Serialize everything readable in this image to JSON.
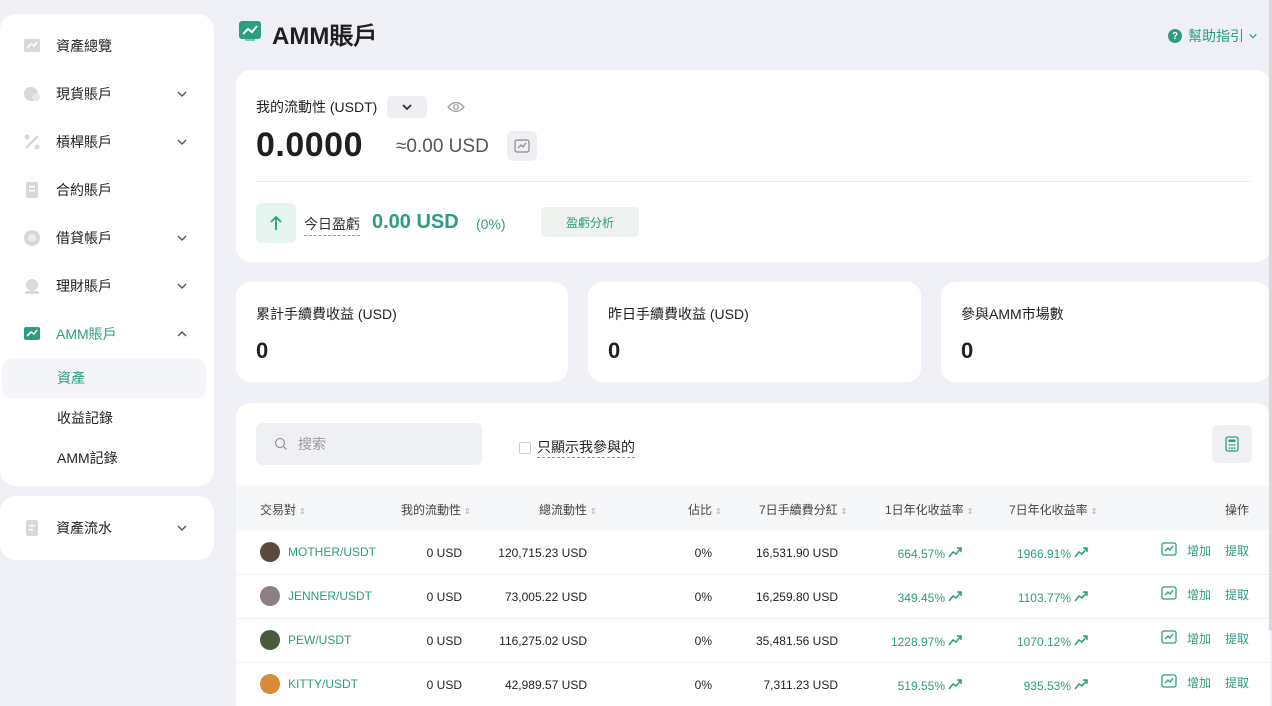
{
  "sidebar": {
    "items": [
      {
        "label": "資產總覽",
        "icon": "asset-overview-icon"
      },
      {
        "label": "現貨賬戶",
        "icon": "spot-account-icon"
      },
      {
        "label": "槓桿賬戶",
        "icon": "margin-account-icon"
      },
      {
        "label": "合約賬戶",
        "icon": "futures-account-icon"
      },
      {
        "label": "借貸帳戶",
        "icon": "loan-account-icon"
      },
      {
        "label": "理財賬戶",
        "icon": "earn-account-icon"
      },
      {
        "label": "AMM賬戶",
        "icon": "amm-account-icon"
      }
    ],
    "amm_sub": [
      "資產",
      "收益記錄",
      "AMM記錄"
    ],
    "flow": {
      "label": "資產流水",
      "icon": "asset-flow-icon"
    }
  },
  "header": {
    "title": "AMM賬戶",
    "help": "幫助指引"
  },
  "liquidity": {
    "label": "我的流動性 (USDT)",
    "value": "0.0000",
    "approx": "≈0.00 USD",
    "pnl_label": "今日盈虧",
    "pnl_value": "0.00 USD",
    "pnl_pct": "(0%)",
    "pnl_button": "盈虧分析"
  },
  "stats": [
    {
      "label": "累計手續費收益 (USD)",
      "value": "0"
    },
    {
      "label": "昨日手續費收益 (USD)",
      "value": "0"
    },
    {
      "label": "參與AMM市場數",
      "value": "0"
    }
  ],
  "table": {
    "search_placeholder": "搜索",
    "only_mine": "只顯示我參與的",
    "columns": [
      "交易對",
      "我的流動性",
      "總流動性",
      "佔比",
      "7日手續費分紅",
      "1日年化收益率",
      "7日年化收益率",
      "操作"
    ],
    "actions": {
      "add": "增加",
      "withdraw": "提取"
    },
    "rows": [
      {
        "pair": "MOTHER/USDT",
        "my": "0 USD",
        "total": "120,715.23 USD",
        "share": "0%",
        "fee7": "16,531.90 USD",
        "apy1": "664.57%",
        "apy7": "1966.91%",
        "coin_color": "#5a4a3e"
      },
      {
        "pair": "JENNER/USDT",
        "my": "0 USD",
        "total": "73,005.22 USD",
        "share": "0%",
        "fee7": "16,259.80 USD",
        "apy1": "349.45%",
        "apy7": "1103.77%",
        "coin_color": "#8d7e86"
      },
      {
        "pair": "PEW/USDT",
        "my": "0 USD",
        "total": "116,275.02 USD",
        "share": "0%",
        "fee7": "35,481.56 USD",
        "apy1": "1228.97%",
        "apy7": "1070.12%",
        "coin_color": "#4b5a3a"
      },
      {
        "pair": "KITTY/USDT",
        "my": "0 USD",
        "total": "42,989.57 USD",
        "share": "0%",
        "fee7": "7,311.23 USD",
        "apy1": "519.55%",
        "apy7": "935.53%",
        "coin_color": "#d98b3a"
      }
    ]
  },
  "colors": {
    "accent": "#2a9d82",
    "background": "#eef0f6"
  }
}
